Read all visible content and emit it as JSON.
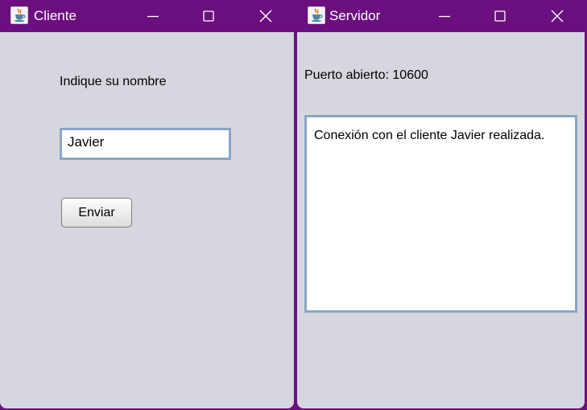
{
  "cliente": {
    "title": "Cliente",
    "icon": "java-cup-icon",
    "prompt_label": "Indique su nombre",
    "name_value": "Javier",
    "send_label": "Enviar"
  },
  "servidor": {
    "title": "Servidor",
    "icon": "java-cup-icon",
    "port_label": "Puerto abierto: 10600",
    "log_text": "Conexión con el cliente Javier realizada."
  },
  "colors": {
    "titlebar": "#6b0f7e",
    "window_bg": "#d6d7de",
    "field_border": "#8aa6c4"
  }
}
